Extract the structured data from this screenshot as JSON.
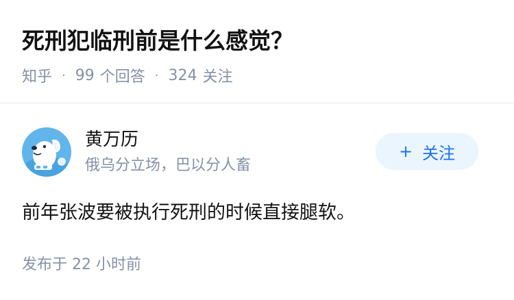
{
  "question": {
    "title": "死刑犯临刑前是什么感觉？",
    "source": "知乎",
    "separator": "·",
    "answers_count": "99",
    "answers_label": "个回答",
    "followers_count": "324",
    "followers_label": "关注"
  },
  "author": {
    "name": "黄万历",
    "bio": "俄乌分立场，巴以分人畜",
    "avatar_icon": "dog-avatar-icon",
    "avatar_color": "#61b5ea"
  },
  "follow_button": {
    "icon": "plus-icon",
    "plus_symbol": "+",
    "label": "关注",
    "bg_color": "#ebf5fd",
    "text_color": "#1772f6"
  },
  "answer": {
    "content": "前年张波要被执行死刑的时候直接腿软。",
    "published": "发布于  22 小时前"
  }
}
